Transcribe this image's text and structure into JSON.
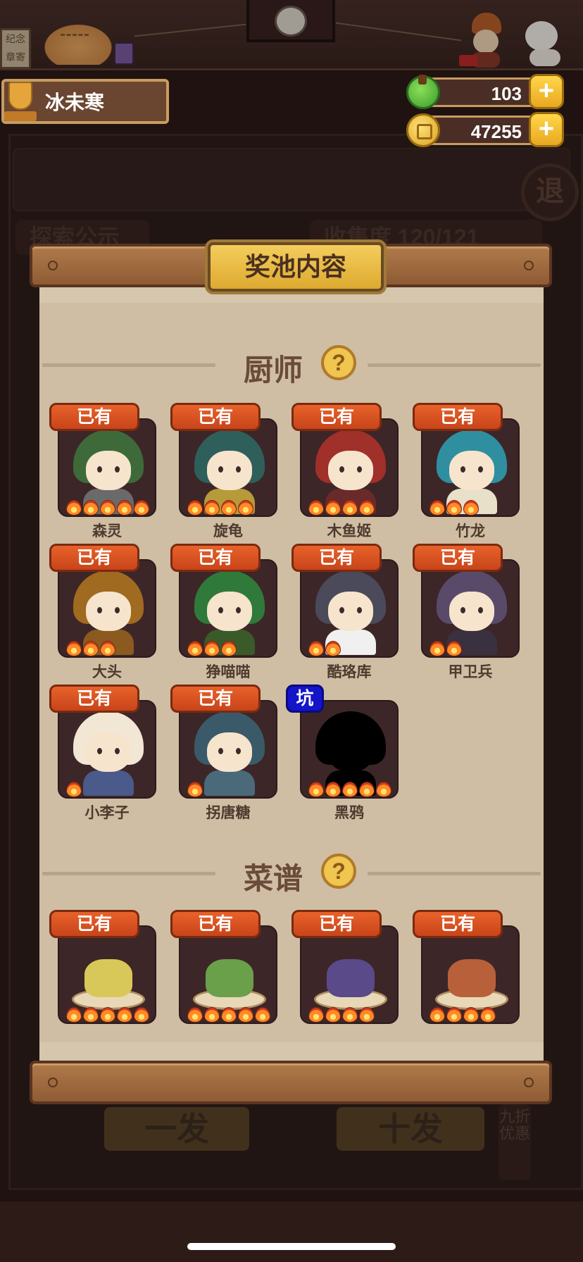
{
  "background": {
    "sign_text": "纪念章寄",
    "exit_glyph": "退",
    "tab_left": "探索公示",
    "tab_right": "收集度 120/121",
    "draw_one": "一发",
    "draw_ten": "十发",
    "discount_note": "九折优惠"
  },
  "player": {
    "name": "冰未寒"
  },
  "resources": [
    {
      "type": "gem",
      "value": "103",
      "add": "+"
    },
    {
      "type": "coin",
      "value": "47255",
      "add": "+"
    }
  ],
  "modal": {
    "title": "奖池内容",
    "sections": [
      {
        "label": "厨师",
        "help": "?",
        "items": [
          {
            "name": "森灵",
            "tag": "已有",
            "stars": 5,
            "hair": "#3e6a3a",
            "body": "#6a6a6a"
          },
          {
            "name": "旋龟",
            "tag": "已有",
            "stars": 4,
            "hair": "#2f5f5a",
            "body": "#b79a3a"
          },
          {
            "name": "木鱼姬",
            "tag": "已有",
            "stars": 4,
            "hair": "#a0302a",
            "body": "#6a2a2a"
          },
          {
            "name": "竹龙",
            "tag": "已有",
            "stars": 3,
            "hair": "#2f8fa0",
            "body": "#e8e0c8"
          },
          {
            "name": "大头",
            "tag": "已有",
            "stars": 3,
            "hair": "#a06a20",
            "body": "#8a5a20"
          },
          {
            "name": "狰喵喵",
            "tag": "已有",
            "stars": 3,
            "hair": "#2f7a3a",
            "body": "#3a5a2a"
          },
          {
            "name": "酷珞库",
            "tag": "已有",
            "stars": 2,
            "hair": "#4a4a5a",
            "body": "#f0f0f0"
          },
          {
            "name": "甲卫兵",
            "tag": "已有",
            "stars": 2,
            "hair": "#5a4a6a",
            "body": "#3a3040"
          },
          {
            "name": "小李子",
            "tag": "已有",
            "stars": 1,
            "hair": "#f2e6d4",
            "body": "#4a5a8a"
          },
          {
            "name": "拐唐糖",
            "tag": "已有",
            "stars": 1,
            "hair": "#3a5a6a",
            "body": "#4a6a7a"
          },
          {
            "name": "黑鸦",
            "tag": "坑",
            "stars": 5,
            "hair": "#000000",
            "body": "#000000",
            "silhouette": true
          }
        ]
      },
      {
        "label": "菜谱",
        "help": "?",
        "items": [
          {
            "name": "",
            "tag": "已有",
            "stars": 5,
            "food": "#d8c85a"
          },
          {
            "name": "",
            "tag": "已有",
            "stars": 5,
            "food": "#6aa04a"
          },
          {
            "name": "",
            "tag": "已有",
            "stars": 4,
            "food": "#5a4a8a"
          },
          {
            "name": "",
            "tag": "已有",
            "stars": 4,
            "food": "#b8603a"
          }
        ]
      }
    ]
  }
}
